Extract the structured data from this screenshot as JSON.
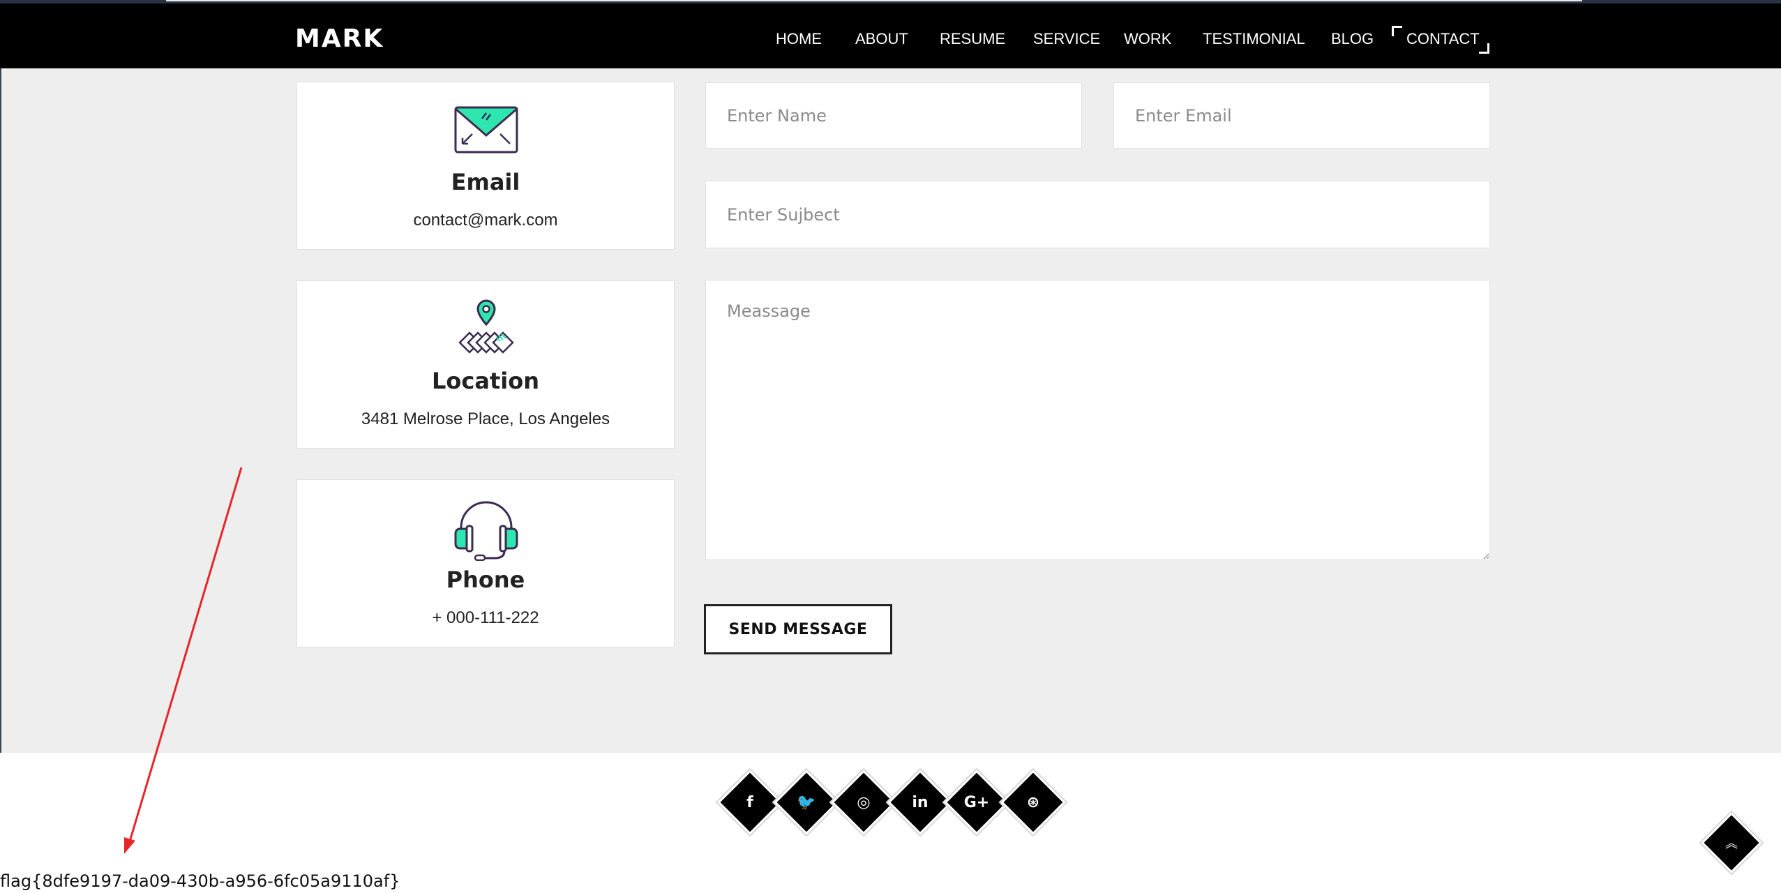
{
  "brand": {
    "logo": "MARK"
  },
  "nav": {
    "items": [
      {
        "label": "HOME"
      },
      {
        "label": "ABOUT"
      },
      {
        "label": "RESUME"
      },
      {
        "label": "SERVICE"
      },
      {
        "label": "WORK"
      },
      {
        "label": "TESTIMONIAL"
      },
      {
        "label": "BLOG"
      },
      {
        "label": "CONTACT",
        "active": true
      }
    ]
  },
  "contact_info": [
    {
      "title": "Email",
      "value": "contact@mark.com",
      "icon": "envelope-icon"
    },
    {
      "title": "Location",
      "value": "3481 Melrose Place, Los Angeles",
      "icon": "map-pin-icon"
    },
    {
      "title": "Phone",
      "value": "+ 000-111-222",
      "icon": "headset-icon"
    }
  ],
  "form": {
    "name_placeholder": "Enter Name",
    "email_placeholder": "Enter Email",
    "subject_placeholder": "Enter Sujbect",
    "message_placeholder": "Meassage",
    "send_label": "SEND MESSAGE"
  },
  "social": [
    {
      "icon": "facebook-icon",
      "glyph": "f"
    },
    {
      "icon": "twitter-icon",
      "glyph": "🐦"
    },
    {
      "icon": "instagram-icon",
      "glyph": "◎"
    },
    {
      "icon": "linkedin-icon",
      "glyph": "in"
    },
    {
      "icon": "google-plus-icon",
      "glyph": "G+"
    },
    {
      "icon": "dribbble-icon",
      "glyph": "⊛"
    }
  ],
  "scroll_top": {
    "icon": "double-chevron-up-icon",
    "glyph": "︽"
  },
  "flag": "flag{8dfe9197-da09-430b-a956-6fc05a9110af}",
  "colors": {
    "accent": "#2ee6b0",
    "dark": "#000000",
    "icon_stroke": "#3a2b4f",
    "annotation_arrow": "#e5262a"
  }
}
